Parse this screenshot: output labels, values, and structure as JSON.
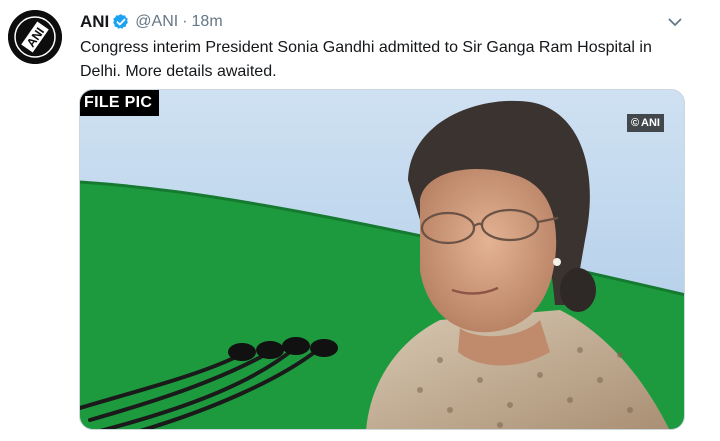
{
  "tweet": {
    "display_name": "ANI",
    "handle": "@ANI",
    "separator": "·",
    "time": "18m",
    "text": "Congress interim President Sonia Gandhi admitted to Sir Ganga Ram Hospital in Delhi. More details awaited.",
    "avatar_text": "ANI"
  },
  "media": {
    "tag": "FILE PIC",
    "watermark": "ANI",
    "watermark_symbol": "©"
  },
  "icons": {
    "verified": "verified-badge-icon",
    "menu": "chevron-down-icon"
  },
  "colors": {
    "text_primary": "#14171a",
    "text_secondary": "#657786",
    "verified_blue": "#1da1f2",
    "backdrop_green": "#1e9a3e",
    "backdrop_blue": "#b7d2ec"
  }
}
